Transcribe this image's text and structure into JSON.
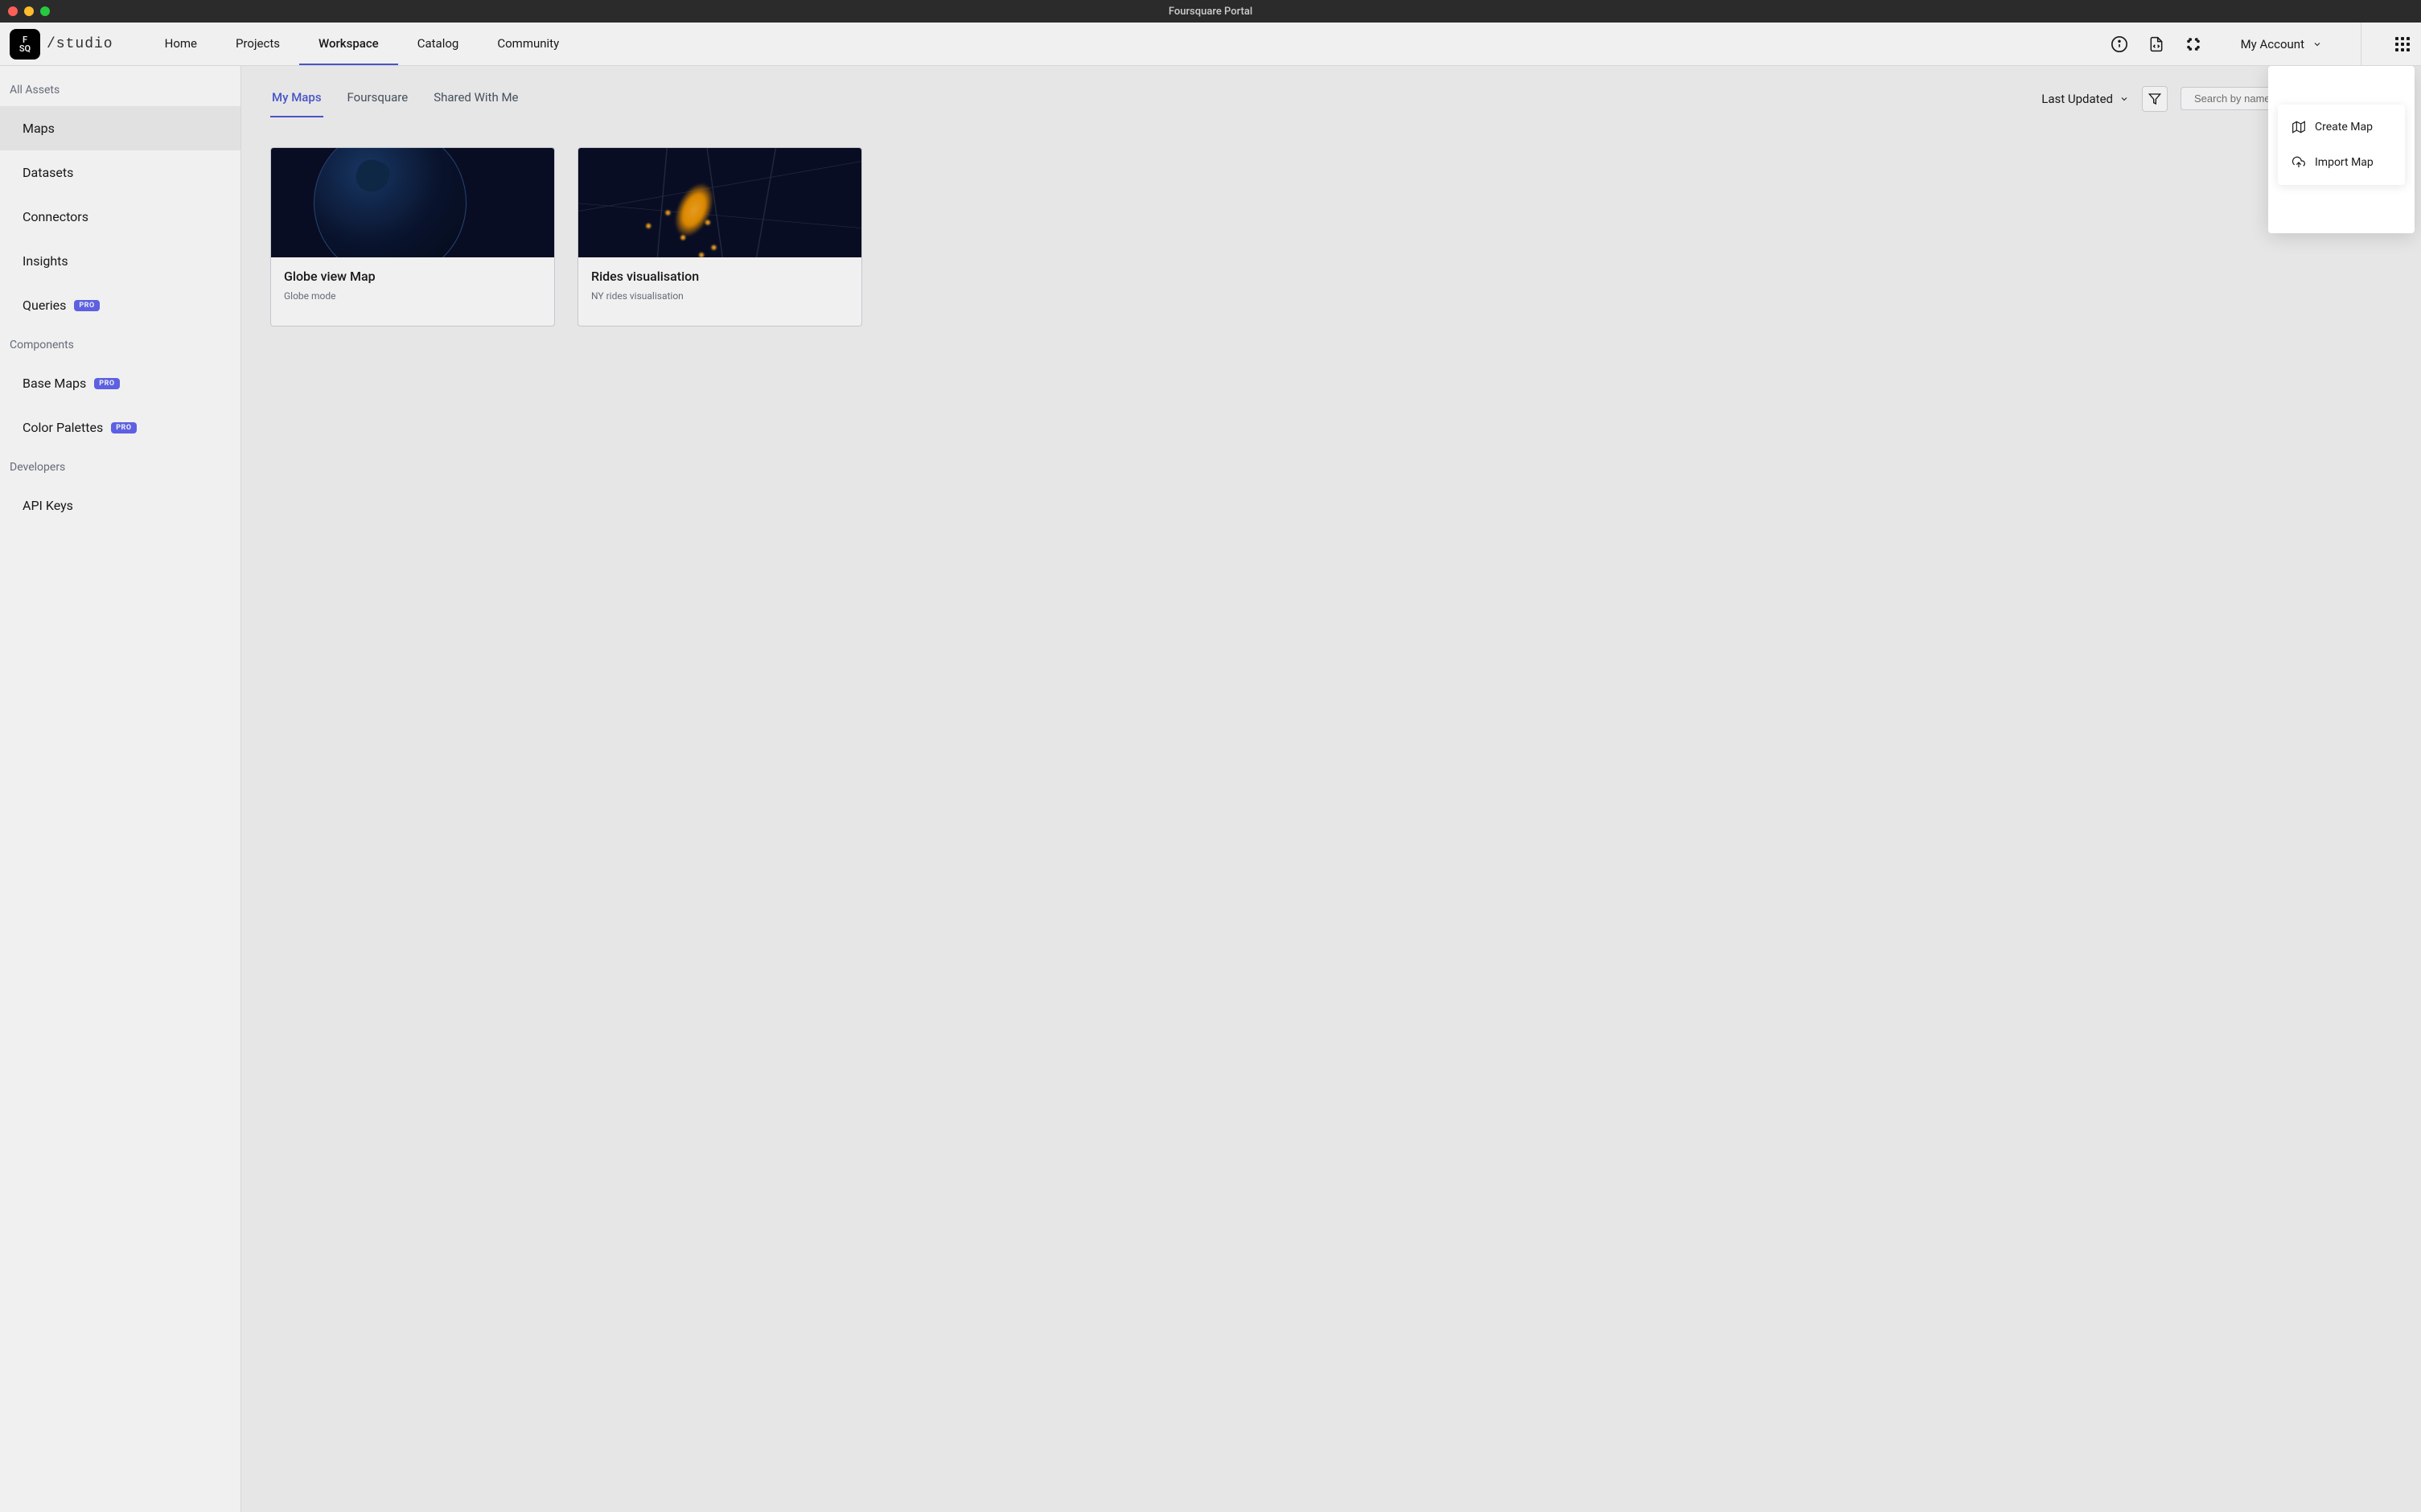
{
  "window": {
    "title": "Foursquare Portal"
  },
  "logo": {
    "sq_line1": "F",
    "sq_line2": "SQ",
    "studio": "/studio"
  },
  "nav": {
    "home": "Home",
    "projects": "Projects",
    "workspace": "Workspace",
    "catalog": "Catalog",
    "community": "Community"
  },
  "account": {
    "label": "My Account"
  },
  "sidebar": {
    "all_assets": "All Assets",
    "maps": "Maps",
    "datasets": "Datasets",
    "connectors": "Connectors",
    "insights": "Insights",
    "queries": "Queries",
    "components": "Components",
    "base_maps": "Base Maps",
    "color_palettes": "Color Palettes",
    "developers": "Developers",
    "api_keys": "API Keys",
    "pro": "PRO"
  },
  "tabs": {
    "my_maps": "My Maps",
    "foursquare": "Foursquare",
    "shared": "Shared With Me"
  },
  "toolbar": {
    "sort": "Last Updated",
    "search_placeholder": "Search by name"
  },
  "cards": [
    {
      "title": "Globe view Map",
      "subtitle": "Globe mode"
    },
    {
      "title": "Rides visualisation",
      "subtitle": "NY rides visualisation"
    }
  ],
  "dropdown": {
    "create": "Create Map",
    "import": "Import Map"
  }
}
